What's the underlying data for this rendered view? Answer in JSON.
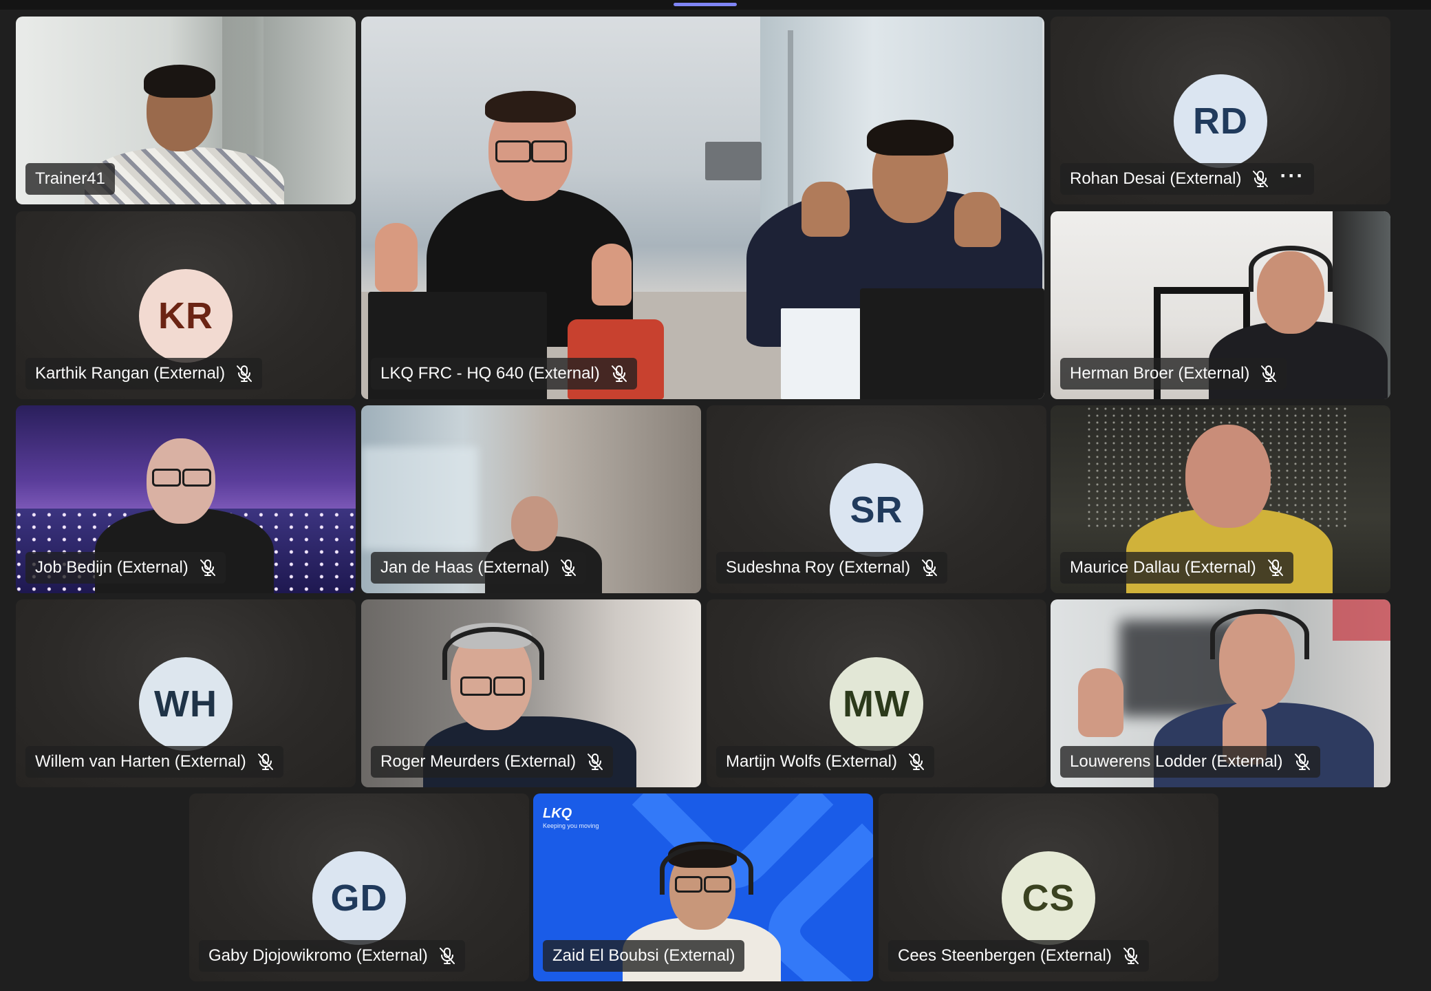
{
  "colors": {
    "accent": "#7f85f5",
    "stage_background": "#1f1f1f",
    "tile_background": "#2c2a28",
    "lkq_brand_blue": "#1a5ce8"
  },
  "participants": [
    {
      "name": "Trainer41",
      "video": true,
      "muted": false
    },
    {
      "name": "LKQ FRC - HQ 640 (External)",
      "video": true,
      "muted": true
    },
    {
      "name": "Rohan Desai (External)",
      "initials": "RD",
      "video": false,
      "muted": true,
      "avatar_color": "#dbe5f1",
      "initials_color": "#203a5c",
      "more_options_icon": "more-horizontal-icon"
    },
    {
      "name": "Karthik Rangan (External)",
      "initials": "KR",
      "video": false,
      "muted": true,
      "avatar_color": "#f2dad1",
      "initials_color": "#6b2414"
    },
    {
      "name": "Herman Broer (External)",
      "video": true,
      "muted": true
    },
    {
      "name": "Job Bedijn (External)",
      "video": true,
      "muted": true
    },
    {
      "name": "Jan de Haas (External)",
      "video": true,
      "muted": true
    },
    {
      "name": "Sudeshna Roy (External)",
      "initials": "SR",
      "video": false,
      "muted": true,
      "avatar_color": "#dbe5f1",
      "initials_color": "#203a5c"
    },
    {
      "name": "Maurice Dallau (External)",
      "video": true,
      "muted": true
    },
    {
      "name": "Willem van Harten (External)",
      "initials": "WH",
      "video": false,
      "muted": true,
      "avatar_color": "#dde6ee",
      "initials_color": "#1f3347"
    },
    {
      "name": "Roger Meurders (External)",
      "video": true,
      "muted": true
    },
    {
      "name": "Martijn Wolfs (External)",
      "initials": "MW",
      "video": false,
      "muted": true,
      "avatar_color": "#e2e7d6",
      "initials_color": "#2c3a1b"
    },
    {
      "name": "Louwerens Lodder (External)",
      "video": true,
      "muted": true
    },
    {
      "name": "Gaby Djojowikromo (External)",
      "initials": "GD",
      "video": false,
      "muted": true,
      "avatar_color": "#dbe5f1",
      "initials_color": "#203a5c"
    },
    {
      "name": "Zaid El Boubsi (External)",
      "video": true,
      "muted": false
    },
    {
      "name": "Cees Steenbergen (External)",
      "initials": "CS",
      "video": false,
      "muted": true,
      "avatar_color": "#e6ead6",
      "initials_color": "#3a4220"
    }
  ],
  "lkq_background": {
    "logo": "LKQ",
    "tagline": "Keeping you moving"
  },
  "icons": {
    "mic": "mic-off-icon",
    "more": "more-horizontal-icon"
  }
}
